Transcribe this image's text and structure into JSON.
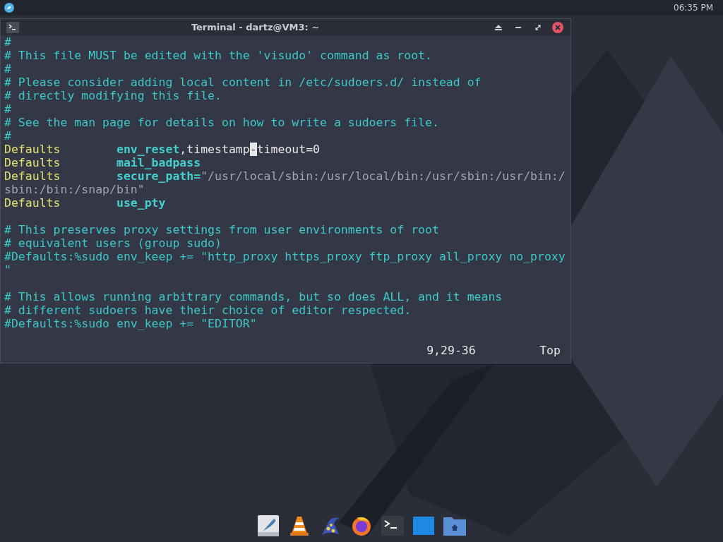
{
  "top_panel": {
    "clock": "06:35 PM"
  },
  "window": {
    "title": "Terminal - dartz@VM3: ~"
  },
  "terminal": {
    "blocks": [
      {
        "lines": [
          {
            "segments": [
              {
                "kind": "comment",
                "text": "#"
              }
            ]
          },
          {
            "segments": [
              {
                "kind": "comment",
                "text": "# This file MUST be edited with the 'visudo' command as root."
              }
            ]
          },
          {
            "segments": [
              {
                "kind": "comment",
                "text": "#"
              }
            ]
          },
          {
            "segments": [
              {
                "kind": "comment",
                "text": "# Please consider adding local content in /etc/sudoers.d/ instead of"
              }
            ]
          },
          {
            "segments": [
              {
                "kind": "comment",
                "text": "# directly modifying this file."
              }
            ]
          },
          {
            "segments": [
              {
                "kind": "comment",
                "text": "#"
              }
            ]
          },
          {
            "segments": [
              {
                "kind": "comment",
                "text": "# See the man page for details on how to write a sudoers file."
              }
            ]
          },
          {
            "segments": [
              {
                "kind": "comment",
                "text": "#"
              }
            ]
          },
          {
            "segments": [
              {
                "kind": "keyword",
                "text": "Defaults        "
              },
              {
                "kind": "option",
                "text": "env_reset"
              },
              {
                "kind": "plain",
                "text": ",timestamp"
              },
              {
                "kind": "cursor",
                "text": "-"
              },
              {
                "kind": "plain",
                "text": "timeout=0"
              }
            ]
          },
          {
            "segments": [
              {
                "kind": "keyword",
                "text": "Defaults        "
              },
              {
                "kind": "option",
                "text": "mail_badpass"
              }
            ]
          },
          {
            "segments": [
              {
                "kind": "keyword",
                "text": "Defaults        "
              },
              {
                "kind": "option",
                "text": "secure_path="
              },
              {
                "kind": "string",
                "text": "\"/usr/local/sbin:/usr/local/bin:/usr/sbin:/usr/bin:/"
              }
            ]
          },
          {
            "segments": [
              {
                "kind": "string",
                "text": "sbin:/bin:/snap/bin\""
              }
            ]
          },
          {
            "segments": [
              {
                "kind": "keyword",
                "text": "Defaults        "
              },
              {
                "kind": "option",
                "text": "use_pty"
              }
            ]
          }
        ]
      },
      {
        "lines": [
          {
            "segments": [
              {
                "kind": "comment",
                "text": "# This preserves proxy settings from user environments of root"
              }
            ]
          },
          {
            "segments": [
              {
                "kind": "comment",
                "text": "# equivalent users (group sudo)"
              }
            ]
          },
          {
            "segments": [
              {
                "kind": "comment",
                "text": "#Defaults:%sudo env_keep += \"http_proxy https_proxy ftp_proxy all_proxy no_proxy"
              }
            ]
          },
          {
            "segments": [
              {
                "kind": "comment",
                "text": "\""
              }
            ]
          }
        ]
      },
      {
        "lines": [
          {
            "segments": [
              {
                "kind": "comment",
                "text": "# This allows running arbitrary commands, but so does ALL, and it means"
              }
            ]
          },
          {
            "segments": [
              {
                "kind": "comment",
                "text": "# different sudoers have their choice of editor respected."
              }
            ]
          },
          {
            "segments": [
              {
                "kind": "comment",
                "text": "#Defaults:%sudo env_keep += \"EDITOR\""
              }
            ]
          }
        ]
      }
    ],
    "status": {
      "position": "9,29-36",
      "scroll": "Top"
    }
  },
  "dock": [
    {
      "kind": "feather"
    },
    {
      "kind": "cone"
    },
    {
      "kind": "wizard"
    },
    {
      "kind": "browser"
    },
    {
      "kind": "terminal"
    },
    {
      "kind": "blue"
    },
    {
      "kind": "folder"
    }
  ]
}
